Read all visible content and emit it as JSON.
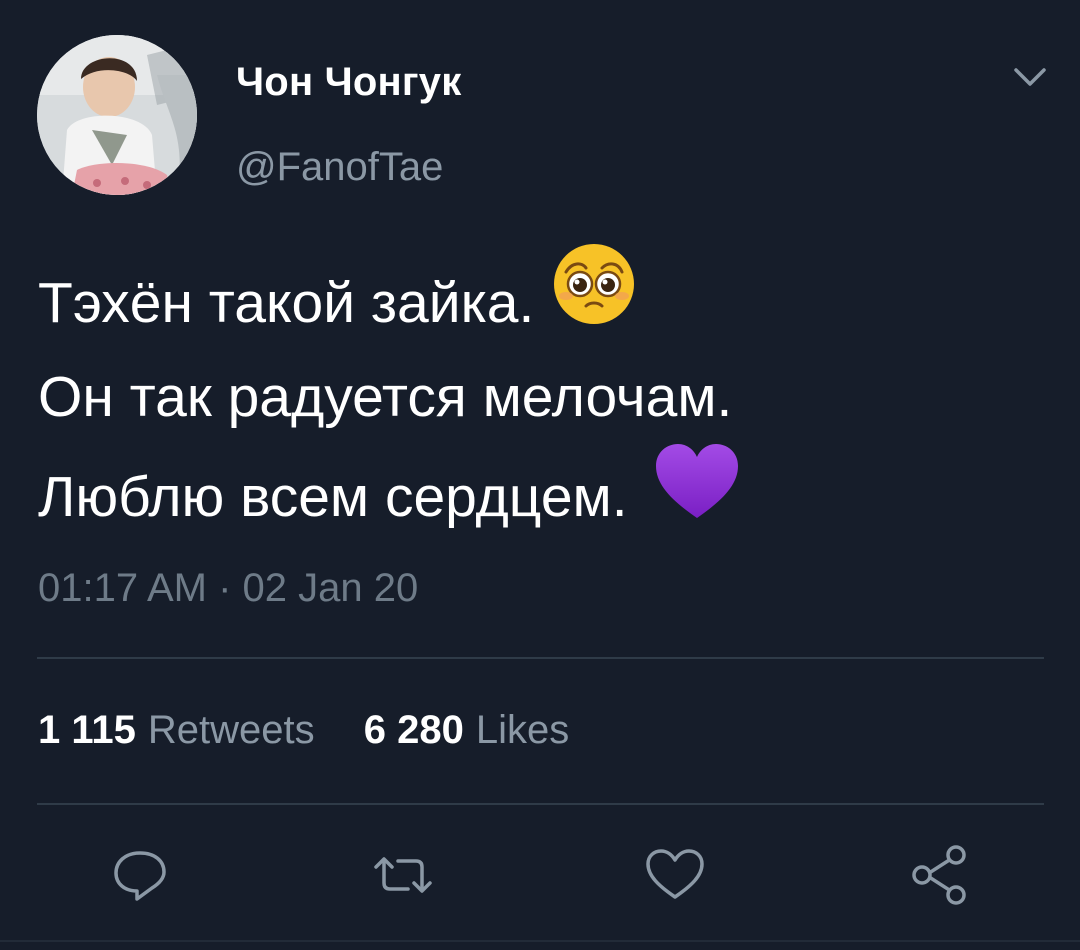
{
  "tweet": {
    "author": {
      "display_name": "Чон Чонгук",
      "handle": "@FanofTae",
      "avatar_icon": "profile-photo"
    },
    "lines": [
      "Тэхён такой зайка.",
      "Он так радуется мелочам.",
      "Люблю всем сердцем."
    ],
    "emojis": [
      "pleading-face-emoji",
      "purple-heart-emoji"
    ],
    "timestamp": "01:17 AM · 02 Jan 20"
  },
  "stats": {
    "retweets_count": "1 115",
    "retweets_label": "Retweets",
    "likes_count": "6 280",
    "likes_label": "Likes"
  },
  "actions": [
    {
      "name": "reply",
      "icon": "reply-icon"
    },
    {
      "name": "retweet",
      "icon": "retweet-icon"
    },
    {
      "name": "like",
      "icon": "heart-icon"
    },
    {
      "name": "share",
      "icon": "share-icon"
    }
  ],
  "colors": {
    "background": "#161d2a",
    "text_primary": "#ffffff",
    "text_secondary": "#8b98a5",
    "divider": "#2f3b48",
    "purple_heart": "#8a2bd0",
    "emoji_yellow": "#f7c227"
  }
}
